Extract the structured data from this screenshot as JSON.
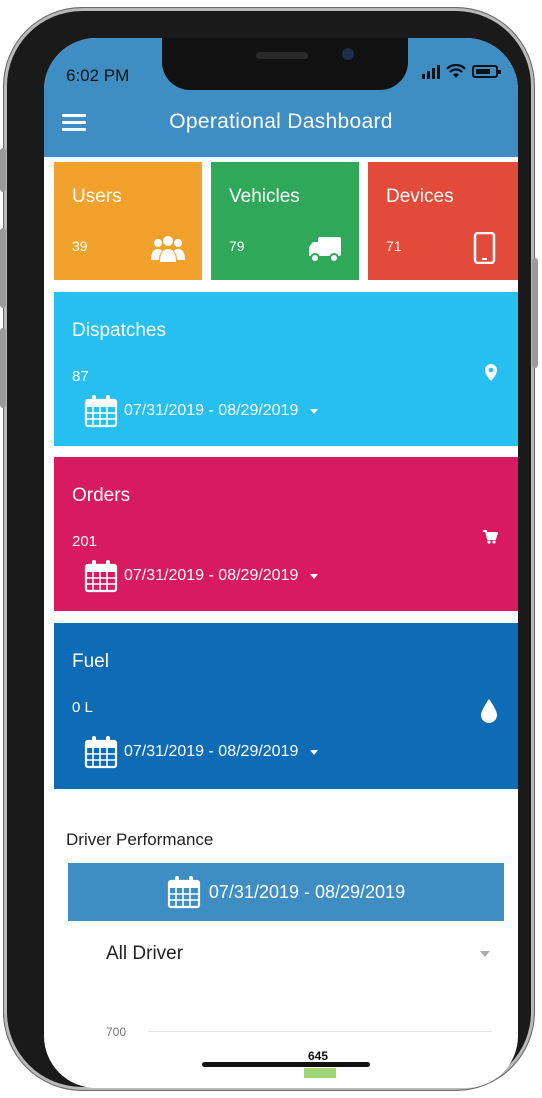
{
  "status_bar": {
    "time": "6:02 PM"
  },
  "header": {
    "title": "Operational Dashboard"
  },
  "tiles": [
    {
      "label": "Users",
      "value": "39",
      "icon": "users-icon",
      "color": "#f0a22c"
    },
    {
      "label": "Vehicles",
      "value": "79",
      "icon": "truck-icon",
      "color": "#2fa85a"
    },
    {
      "label": "Devices",
      "value": "71",
      "icon": "tablet-icon",
      "color": "#e24b3a"
    }
  ],
  "cards": {
    "dispatches": {
      "label": "Dispatches",
      "value": "87",
      "date_range": "07/31/2019 - 08/29/2019",
      "icon": "map-pin-icon",
      "color": "#27bff0"
    },
    "orders": {
      "label": "Orders",
      "value": "201",
      "date_range": "07/31/2019 - 08/29/2019",
      "icon": "cart-icon",
      "color": "#d81b60"
    },
    "fuel": {
      "label": "Fuel",
      "value": "0 L",
      "date_range": "07/31/2019 - 08/29/2019",
      "icon": "drop-icon",
      "color": "#0d6cb5"
    }
  },
  "driver_performance": {
    "title": "Driver Performance",
    "date_range": "07/31/2019 - 08/29/2019",
    "driver_select": "All Driver",
    "chart": {
      "y_tick": "700",
      "bar_label": "645"
    }
  },
  "colors": {
    "header": "#3e8dc3"
  }
}
